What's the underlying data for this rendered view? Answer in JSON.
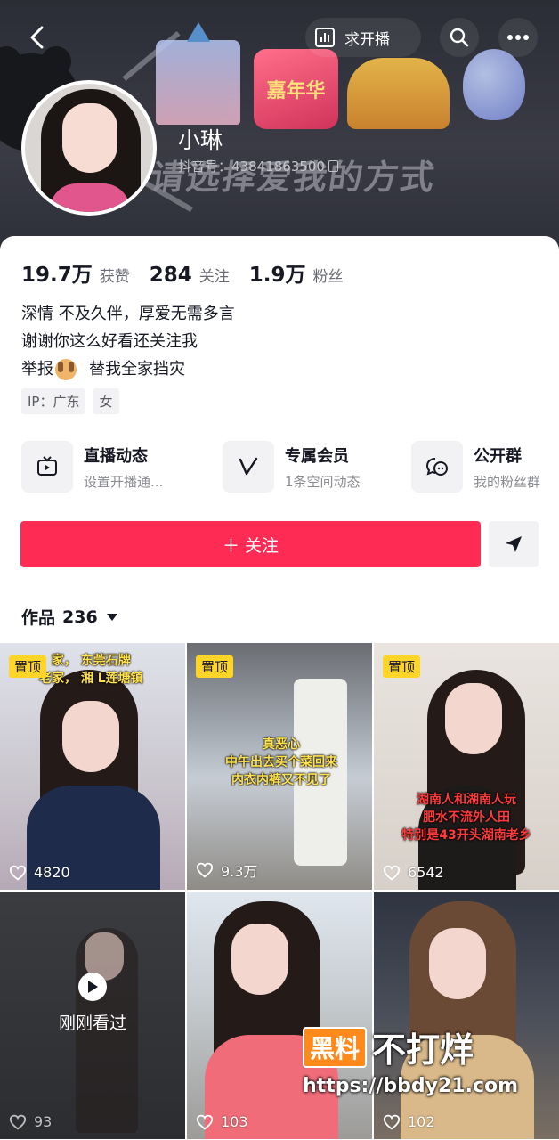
{
  "colors": {
    "accent": "#fe2c55",
    "pin_badge": "#ffd527",
    "caption_yellow": "#ffe24d",
    "caption_red": "#ff3b3b"
  },
  "header": {
    "back_icon": "chevron-left-icon",
    "live_request_icon": "bar-chart-icon",
    "live_request_label": "求开播",
    "search_icon": "search-icon",
    "more_icon": "more-dots-icon"
  },
  "banner": {
    "carnival_text": "嘉年华",
    "slogan": "请选择爱我的方式"
  },
  "profile": {
    "nickname": "小琳",
    "douyin_id": "抖音号：43841863500"
  },
  "stats": [
    {
      "value": "19.7万",
      "label": "获赞"
    },
    {
      "value": "284",
      "label": "关注"
    },
    {
      "value": "1.9万",
      "label": "粉丝"
    }
  ],
  "bio": {
    "line1": "深情  不及久伴，厚爱无需多言",
    "line2": "谢谢你这么好看还关注我",
    "line3_a": "举报",
    "line3_b": "替我全家挡灾"
  },
  "tags": [
    "IP：广东",
    "女"
  ],
  "features": [
    {
      "icon": "tv-icon",
      "title": "直播动态",
      "subtitle": "设置开播通..."
    },
    {
      "icon": "v-badge-icon",
      "title": "专属会员",
      "subtitle": "1条空间动态"
    },
    {
      "icon": "group-chat-icon",
      "title": "公开群",
      "subtitle": "我的粉丝群"
    }
  ],
  "actions": {
    "follow_label": "＋ 关注",
    "share_icon": "send-icon"
  },
  "works": {
    "label": "作品",
    "count": "236"
  },
  "pin_label": "置顶",
  "videos": [
    {
      "pinned": true,
      "likes": "4820",
      "caption": [
        "东莞石牌",
        "湘 L莲塘镇"
      ],
      "caption_prefix": [
        "家，",
        "老家，"
      ]
    },
    {
      "pinned": true,
      "likes": "9.3万",
      "caption": [
        "真恶心",
        "中午出去买个菜回来",
        "内衣内裤又不见了"
      ]
    },
    {
      "pinned": true,
      "likes": "6542",
      "caption": [
        "湖南人和湖南人玩",
        "肥水不流外人田",
        "特别是43开头湖南老乡"
      ]
    },
    {
      "pinned": false,
      "likes": "93",
      "overlay": "刚刚看过"
    },
    {
      "pinned": false,
      "likes": "103"
    },
    {
      "pinned": false,
      "likes": "102"
    }
  ],
  "watermark": {
    "logo": "黑料",
    "brand": "不打烊",
    "url": "https://bbdy21.com"
  }
}
